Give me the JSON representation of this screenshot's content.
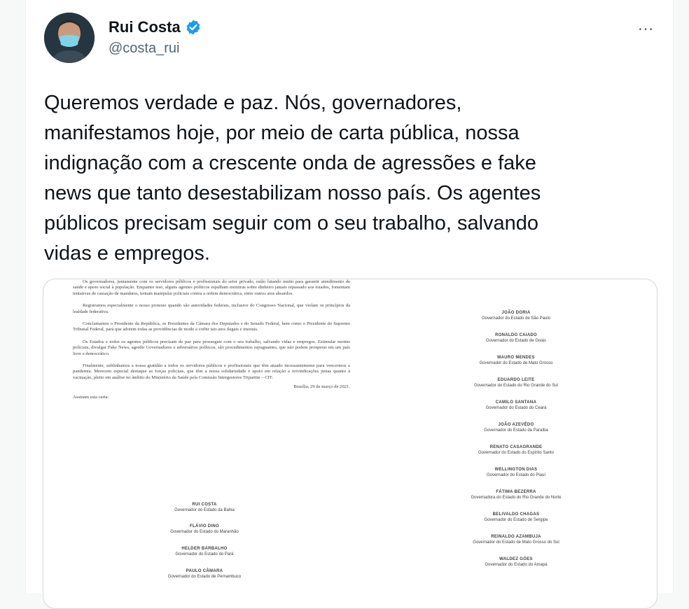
{
  "author": {
    "name": "Rui Costa",
    "handle": "@costa_rui",
    "verified_color": "#1d9bf0"
  },
  "more_icon": "…",
  "tweet": {
    "text": "Queremos verdade e paz. Nós, governadores,\nmanifestamos hoje, por meio de carta pública, nossa\nindignação com a crescente onda de agressões e fake\nnews que tanto desestabilizam nosso país. Os agentes\npúblicos precisam seguir com o seu trabalho, salvando\nvidas e empregos."
  },
  "letter": {
    "paragraphs": [
      "Os governadores, juntamente com os servidores públicos e profissionais do setor privado, estão lutando muito para garantir atendimento de saúde e apoio social à população. Enquanto isso, alguns agentes políticos espalham mentiras sobre dinheiro jamais repassado aos estados, fomentam tentativas de cassação de mandatos, tentam manipular policiais contra a ordem democrática, entre outros atos absurdos.",
      "Registramos especialmente o nosso protesto quando são autoridades federais, inclusive do Congresso Nacional, que violam os princípios da lealdade federativa.",
      "Conclamamos o Presidente da República, os Presidentes da Câmara dos Deputados e do Senado Federal, bem como o Presidente do Supremo Tribunal Federal, para que adotem todas as providências de modo a coibir tais atos ilegais e imorais.",
      "Os Estados e todos os agentes públicos precisam de paz para prosseguir com o seu trabalho, salvando vidas e empregos. Estimular motins policiais, divulgar Fake News, agredir Governadores e adversários políticos, são procedimentos repugnantes, que não podem prosperar em um país livre e democrático.",
      "Finalmente, sublinhamos a nossa gratidão a todos os servidores públicos e profissionais que têm atuado incessantemente para vencermos a pandemia. Merecem especial destaque as forças policiais, que têm a nossa solidariedade e apoio em relação a reivindicações justas quanto à vacinação, pleito em análise no âmbito do Ministério da Saúde pela Comissão Intergestores Tripartite – CIT."
    ],
    "date": "Brasília, 29 de março de 2021.",
    "sign_intro": "Assinam esta carta:",
    "signatories_left": [
      {
        "name": "RUI COSTA",
        "role": "Governador do Estado da Bahia"
      },
      {
        "name": "FLÁVIO DINO",
        "role": "Governador do Estado do Maranhão"
      },
      {
        "name": "HELDER BARBALHO",
        "role": "Governador do Estado do Pará"
      },
      {
        "name": "PAULO CÂMARA",
        "role": "Governador do Estado de Pernambuco"
      }
    ],
    "signatories_right": [
      {
        "name": "JOÃO DORIA",
        "role": "Governador do Estado de São Paulo"
      },
      {
        "name": "RONALDO CAIADO",
        "role": "Governador do Estado de Goiás"
      },
      {
        "name": "MAURO MENDES",
        "role": "Governador do Estado de Mato Grosso"
      },
      {
        "name": "EDUARDO LEITE",
        "role": "Governador do Estado do Rio Grande do Sul"
      },
      {
        "name": "CAMILO SANTANA",
        "role": "Governador do Estado do Ceará"
      },
      {
        "name": "JOÃO AZEVÊDO",
        "role": "Governador do Estado da Paraíba"
      },
      {
        "name": "RENATO CASAGRANDE",
        "role": "Governador do Estado do Espírito Santo"
      },
      {
        "name": "WELLINGTON DIAS",
        "role": "Governador do Estado do Piauí"
      },
      {
        "name": "FÁTIMA BEZERRA",
        "role": "Governadora do Estado do Rio Grande do Norte"
      },
      {
        "name": "BELIVALDO CHAGAS",
        "role": "Governador do Estado de Sergipe"
      },
      {
        "name": "REINALDO AZAMBUJA",
        "role": "Governador do Estado de Mato Grosso do Sul"
      },
      {
        "name": "WALDEZ GÓES",
        "role": "Governador do Estado do Amapá"
      }
    ]
  }
}
